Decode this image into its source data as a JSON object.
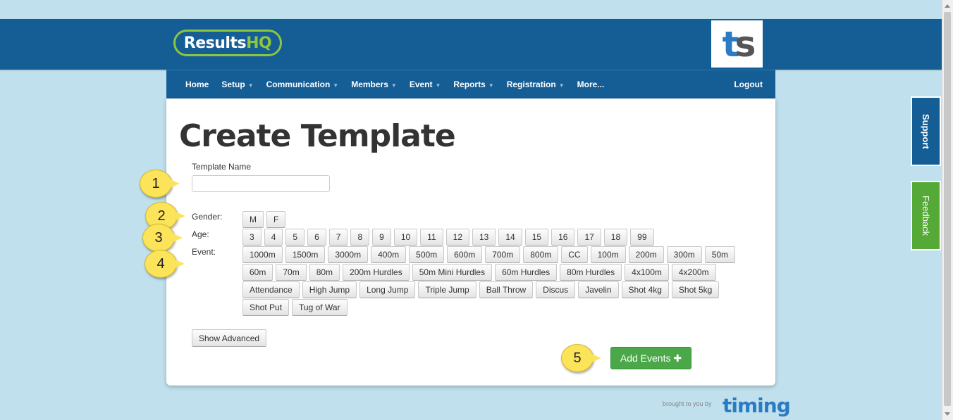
{
  "header": {
    "logo_main": "Results",
    "logo_accent": "HQ",
    "partner_logo_t": "t",
    "partner_logo_s": "s"
  },
  "nav": {
    "items": [
      {
        "label": "Home",
        "dropdown": false
      },
      {
        "label": "Setup",
        "dropdown": true
      },
      {
        "label": "Communication",
        "dropdown": true
      },
      {
        "label": "Members",
        "dropdown": true
      },
      {
        "label": "Event",
        "dropdown": true
      },
      {
        "label": "Reports",
        "dropdown": true
      },
      {
        "label": "Registration",
        "dropdown": true
      },
      {
        "label": "More...",
        "dropdown": false
      }
    ],
    "logout": "Logout"
  },
  "page": {
    "title": "Create Template",
    "template_name_label": "Template Name",
    "template_name_value": "",
    "gender_label": "Gender:",
    "age_label": "Age:",
    "event_label": "Event:",
    "gender_options": [
      "M",
      "F"
    ],
    "age_options": [
      "3",
      "4",
      "5",
      "6",
      "7",
      "8",
      "9",
      "10",
      "11",
      "12",
      "13",
      "14",
      "15",
      "16",
      "17",
      "18",
      "99"
    ],
    "event_rows": [
      [
        "1000m",
        "1500m",
        "3000m",
        "400m",
        "500m",
        "600m",
        "700m",
        "800m",
        "CC",
        "100m",
        "200m",
        "300m",
        "50m"
      ],
      [
        "60m",
        "70m",
        "80m",
        "200m Hurdles",
        "50m Mini Hurdles",
        "60m Hurdles",
        "80m Hurdles",
        "4x100m",
        "4x200m"
      ],
      [
        "Attendance",
        "High Jump",
        "Long Jump",
        "Triple Jump",
        "Ball Throw",
        "Discus",
        "Javelin",
        "Shot 4kg",
        "Shot 5kg"
      ],
      [
        "Shot Put",
        "Tug of War"
      ]
    ],
    "show_advanced": "Show Advanced",
    "add_events": "Add Events ✚"
  },
  "callouts": [
    "1",
    "2",
    "3",
    "4",
    "5"
  ],
  "side_tabs": {
    "support": "Support",
    "feedback": "Feedback"
  },
  "footer": {
    "brought_by": "brought to you by",
    "brand": "timing"
  },
  "colors": {
    "primary": "#155d95",
    "accent_green": "#8dc63f",
    "button_green": "#4aa848",
    "callout_yellow": "#fbe35a",
    "background": "#bfe0ec"
  }
}
